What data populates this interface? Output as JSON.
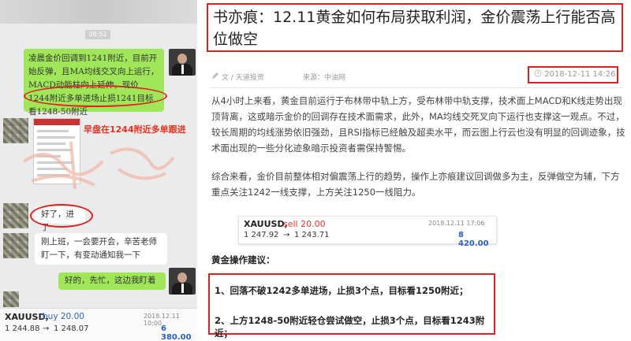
{
  "chat": {
    "timestamp": "08:52",
    "msg1": "凌晨金价回调到1241附近，目前开始反弹，且MA均线交叉向上运行，MACD动能柱向上延伸，现价1244附近多单进场止损1241目标看1248-50附近",
    "annotation": "早盘在1244附近多单跟进",
    "msg2": "好了，进了",
    "msg3": "刚上班，一会要开会，辛苦老师盯一下，有变动通知我一下",
    "msg4": "好的，先忙，这边我盯着",
    "footer": {
      "symbol": "XAUUSD,",
      "action": "buy 20.00",
      "date": "2018.12.11 10:00",
      "price_from": "1 244.88",
      "arrow": "→",
      "price_to": "1 248.07",
      "profit": "6 380.00"
    }
  },
  "article": {
    "title": "书亦痕：12.11黄金如何布局获取利润，金价震荡上行能否高位做空",
    "author": "文 / 天道投资",
    "source": "来源：中油网",
    "date": "2018-12-11 14:26",
    "para1": "从4小时上来看，黄金目前运行于布林带中轨上方，受布林带中轨支撑，技术面上MACD和K线走势出现顶背离，这或暗示金价的回调存在技术面需求，此外，MA均线交死叉向下运行也支撑这一观点。不过，较长周期的均线涨势依旧强劲，且RSI指标已经触及超卖水平，而云图上行云也没有明显的回调迹象，技术面出现的一些分化迹象暗示投资者需保持警惕。",
    "para2": "综合来看，金价目前整体相对偏震荡上行的趋势，操作上亦痕建议回调做多为主，反弹做空为辅，下方重点关注1242一线支撑，上方关注1250一线阻力。",
    "trade": {
      "symbol": "XAUUSD,",
      "action": "sell 20.00",
      "date": "2018.12.11 17:06",
      "price_from": "1 247.92",
      "arrow": "→",
      "price_to": "1 243.71",
      "profit": "8 420.00"
    },
    "section_title": "黄金操作建议：",
    "advice1": "1、回落不破1242多单进场，止损3个点，目标看1250附近；",
    "advice2": "2、上方1248-50附近轻仓尝试做空，止损3个点，目标看1243附近；"
  }
}
